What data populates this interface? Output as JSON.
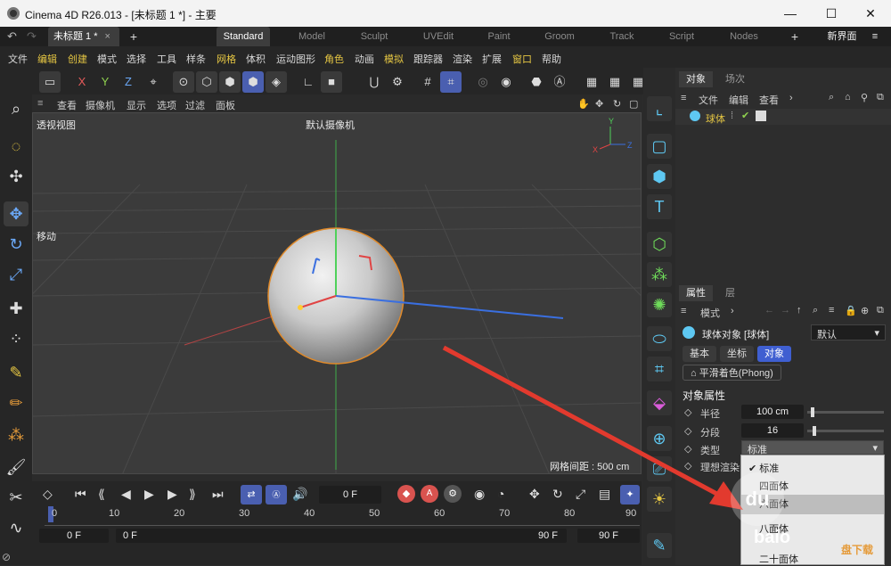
{
  "window": {
    "title": "Cinema 4D R26.013 - [未标题 1 *] - 主要"
  },
  "docs": {
    "current": "未标题 1 *"
  },
  "layouts": [
    "Standard",
    "Model",
    "Sculpt",
    "UVEdit",
    "Paint",
    "Groom",
    "Track",
    "Script",
    "Nodes"
  ],
  "new_layout": "新界面",
  "menu": [
    "文件",
    "编辑",
    "创建",
    "模式",
    "选择",
    "工具",
    "样条",
    "网格",
    "体积",
    "运动图形",
    "角色",
    "动画",
    "模拟",
    "跟踪器",
    "渲染",
    "扩展",
    "窗口",
    "帮助"
  ],
  "menu_highlight": [
    "编辑",
    "创建",
    "网格",
    "角色",
    "模拟",
    "窗口"
  ],
  "axes": {
    "x": "X",
    "y": "Y",
    "z": "Z"
  },
  "viewport": {
    "menu": [
      "查看",
      "摄像机",
      "显示",
      "选项",
      "过滤",
      "面板"
    ],
    "name": "透视视图",
    "camera": "默认摄像机",
    "tool_label": "移动",
    "grid_spacing": "网格间距 : 500 cm"
  },
  "timeline": {
    "current_frame": "0 F",
    "ruler": [
      "0",
      "10",
      "20",
      "30",
      "40",
      "50",
      "60",
      "70",
      "80",
      "90"
    ],
    "start": "0 F",
    "min": "0 F",
    "max": "90 F",
    "end": "90 F"
  },
  "object_manager": {
    "tabs": [
      "对象",
      "场次"
    ],
    "menu": [
      "文件",
      "编辑",
      "查看"
    ],
    "objects": [
      {
        "name": "球体"
      }
    ]
  },
  "attributes": {
    "tabs": [
      "属性",
      "层"
    ],
    "mode": "模式",
    "object_title": "球体对象 [球体]",
    "preset": "默认",
    "subtabs": [
      "基本",
      "坐标",
      "对象"
    ],
    "phong_tag": "平滑着色(Phong)",
    "section": "对象属性",
    "radius_label": "半径",
    "radius": "100 cm",
    "segments_label": "分段",
    "segments": "16",
    "type_label": "类型",
    "type_value": "标准",
    "ideal_label": "理想渲染"
  },
  "type_options": [
    "标准",
    "四面体",
    "六面体",
    "八面体",
    "二十面体"
  ],
  "watermark": {
    "text": "baio",
    "site": "盘下载"
  },
  "status": "⊘"
}
